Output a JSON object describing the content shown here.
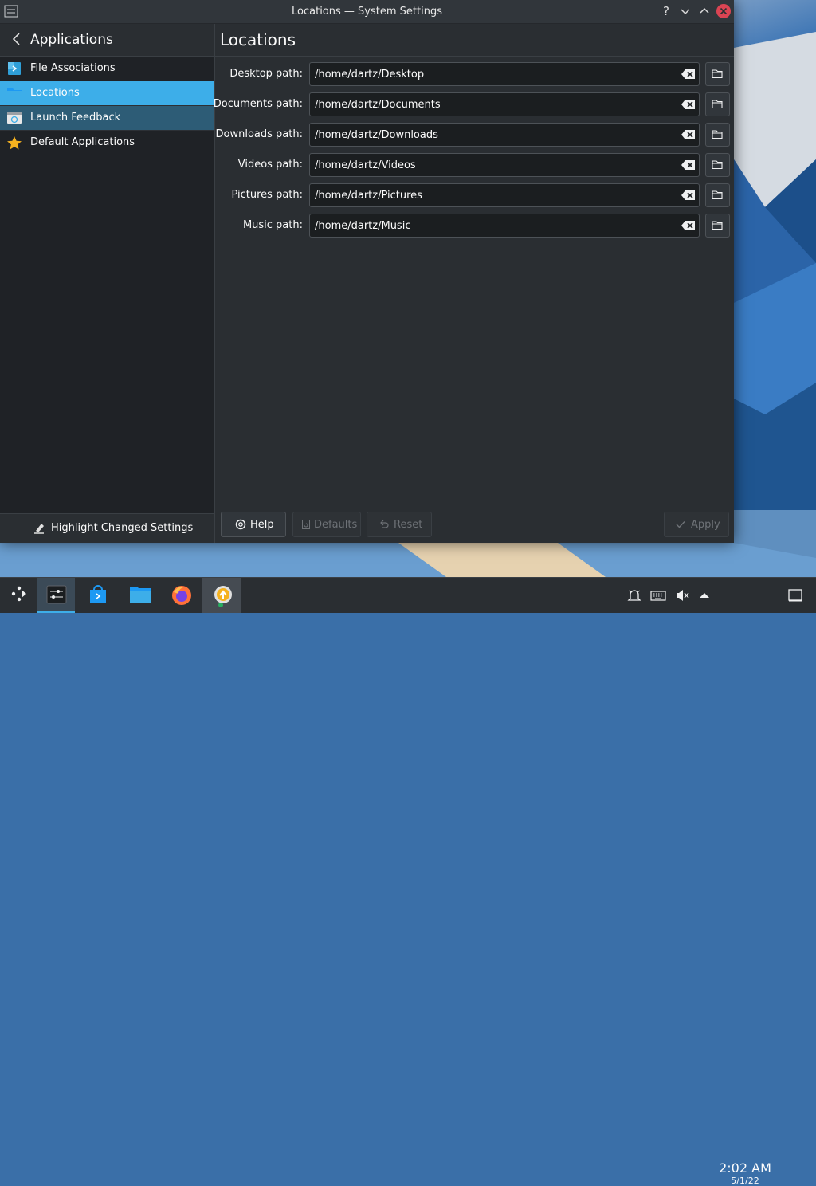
{
  "window": {
    "title": "Locations — System Settings"
  },
  "sidebar": {
    "header_title": "Applications",
    "items": [
      {
        "label": "File Associations",
        "icon": "file-associations-icon"
      },
      {
        "label": "Locations",
        "icon": "folder-icon"
      },
      {
        "label": "Launch Feedback",
        "icon": "launch-feedback-icon"
      },
      {
        "label": "Default Applications",
        "icon": "star-icon"
      }
    ],
    "footer_label": "Highlight Changed Settings"
  },
  "main": {
    "title": "Locations",
    "paths": [
      {
        "label": "Desktop path:",
        "value": "/home/dartz/Desktop"
      },
      {
        "label": "Documents path:",
        "value": "/home/dartz/Documents"
      },
      {
        "label": "Downloads path:",
        "value": "/home/dartz/Downloads"
      },
      {
        "label": "Videos path:",
        "value": "/home/dartz/Videos"
      },
      {
        "label": "Pictures path:",
        "value": "/home/dartz/Pictures"
      },
      {
        "label": "Music path:",
        "value": "/home/dartz/Music"
      }
    ]
  },
  "buttons": {
    "help": "Help",
    "defaults": "Defaults",
    "reset": "Reset",
    "apply": "Apply"
  },
  "taskbar": {
    "time": "2:02 AM",
    "date": "5/1/22"
  },
  "colors": {
    "accent": "#3daee9",
    "close": "#da4453",
    "background": "#2a2e32"
  }
}
